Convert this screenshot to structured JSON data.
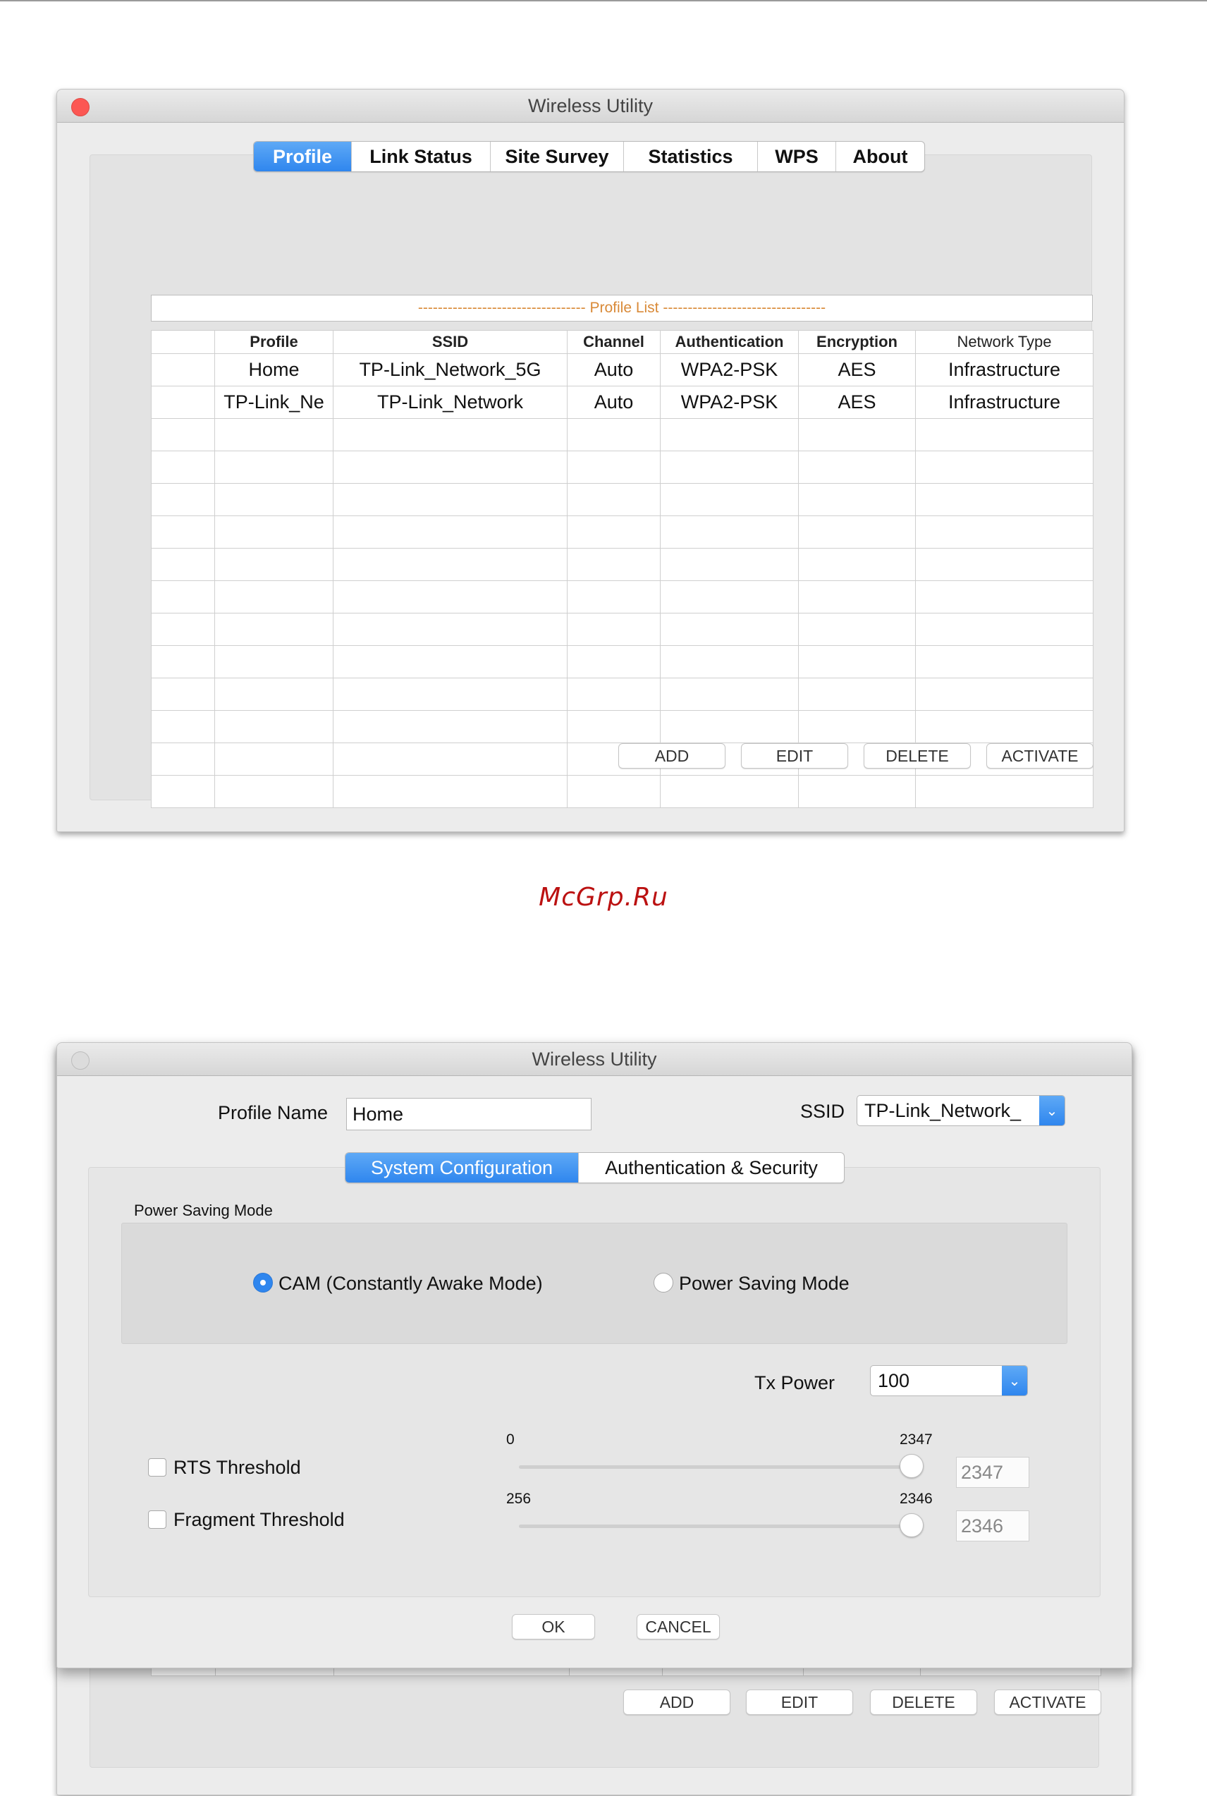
{
  "window1": {
    "title": "Wireless Utility",
    "tabs": [
      "Profile",
      "Link Status",
      "Site Survey",
      "Statistics",
      "WPS",
      "About"
    ],
    "active_tab": "Profile",
    "profile_list_caption": "---------------------------------- Profile List ---------------------------------",
    "columns": [
      "",
      "Profile",
      "SSID",
      "Channel",
      "Authentication",
      "Encryption",
      "Network Type"
    ],
    "rows": [
      [
        "",
        "Home",
        "TP-Link_Network_5G",
        "Auto",
        "WPA2-PSK",
        "AES",
        "Infrastructure"
      ],
      [
        "",
        "TP-Link_Ne",
        "TP-Link_Network",
        "Auto",
        "WPA2-PSK",
        "AES",
        "Infrastructure"
      ]
    ],
    "buttons": {
      "add": "ADD",
      "edit": "EDIT",
      "delete": "DELETE",
      "activate": "ACTIVATE"
    }
  },
  "watermark": "McGrp.Ru",
  "window2": {
    "title": "Wireless Utility",
    "profile_name_label": "Profile Name",
    "profile_name_value": "Home",
    "ssid_label": "SSID",
    "ssid_value": "TP-Link_Network_",
    "tabs": [
      "System Configuration",
      "Authentication & Security"
    ],
    "active_tab": "System Configuration",
    "power_saving": {
      "group_label": "Power Saving Mode",
      "option_cam": "CAM (Constantly Awake Mode)",
      "option_psm": "Power Saving Mode",
      "selected": "CAM (Constantly Awake Mode)"
    },
    "tx_power": {
      "label": "Tx Power",
      "value": "100"
    },
    "rts": {
      "label": "RTS Threshold",
      "checked": false,
      "min": "0",
      "max": "2347",
      "value": "2347"
    },
    "fragment": {
      "label": "Fragment Threshold",
      "checked": false,
      "min": "256",
      "max": "2346",
      "value": "2346"
    },
    "buttons": {
      "ok": "OK",
      "cancel": "CANCEL"
    }
  },
  "window3": {
    "buttons": {
      "add": "ADD",
      "edit": "EDIT",
      "delete": "DELETE",
      "activate": "ACTIVATE"
    }
  }
}
